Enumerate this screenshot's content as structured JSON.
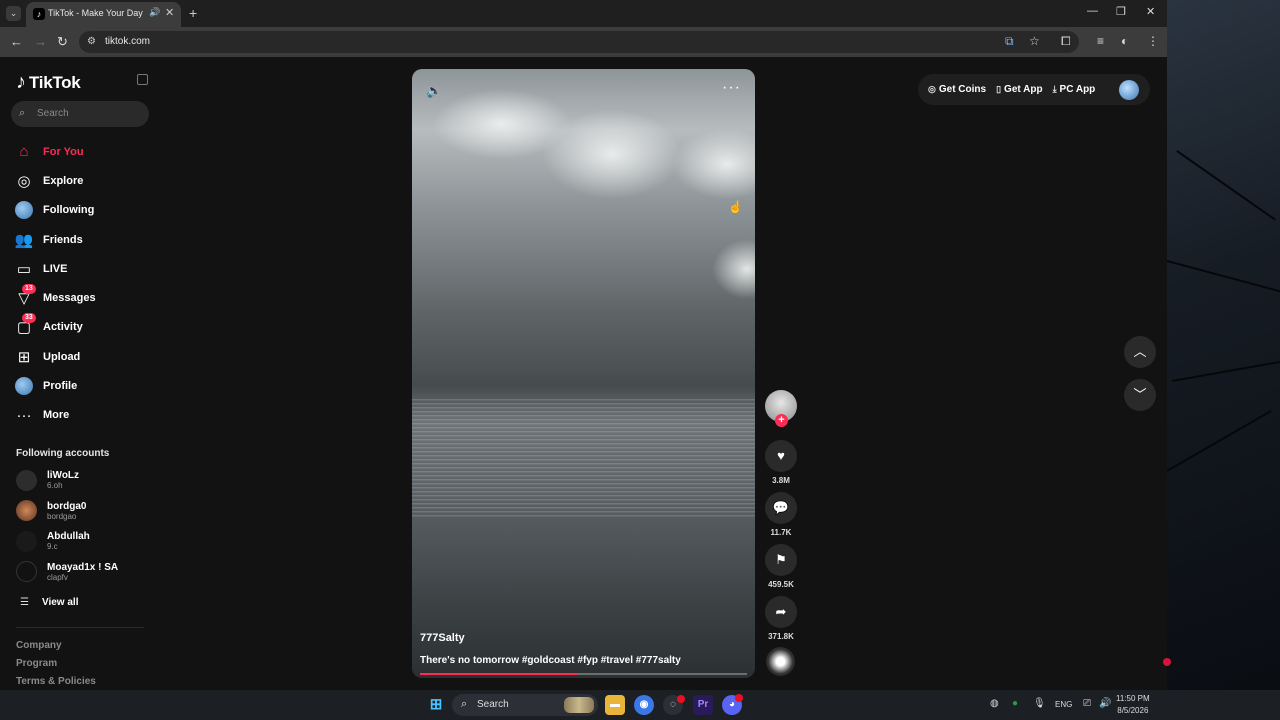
{
  "browser": {
    "tab_title": "TikTok - Make Your Day",
    "tab_favicon": "♪",
    "url": "tiktok.com"
  },
  "sidebar": {
    "logo_text": "TikTok",
    "search_placeholder": "Search",
    "nav": [
      {
        "label": "For You",
        "icon": "home-icon",
        "active": true
      },
      {
        "label": "Explore",
        "icon": "compass-icon"
      },
      {
        "label": "Following",
        "icon": "following-avatar-icon"
      },
      {
        "label": "Friends",
        "icon": "friends-icon"
      },
      {
        "label": "LIVE",
        "icon": "live-tv-icon"
      },
      {
        "label": "Messages",
        "icon": "messages-icon",
        "badge": "13"
      },
      {
        "label": "Activity",
        "icon": "activity-icon",
        "badge": "33"
      },
      {
        "label": "Upload",
        "icon": "upload-icon"
      },
      {
        "label": "Profile",
        "icon": "profile-avatar-icon"
      },
      {
        "label": "More",
        "icon": "more-icon"
      }
    ],
    "following_title": "Following accounts",
    "following": [
      {
        "name": "liWoLz",
        "handle": "6.oh"
      },
      {
        "name": "bordga0",
        "handle": "bordgao"
      },
      {
        "name": "Abdullah",
        "handle": "9.c"
      },
      {
        "name": "Moayad1x ! SA",
        "handle": "clapfv"
      }
    ],
    "view_all": "View all",
    "footer": [
      "Company",
      "Program",
      "Terms & Policies"
    ]
  },
  "video": {
    "author": "777Salty",
    "caption": "There's no tomorrow #goldcoast #fyp #travel #777salty",
    "progress": 0.48
  },
  "actions": {
    "likes": "3.8M",
    "comments": "11.7K",
    "saves": "459.5K",
    "shares": "371.8K"
  },
  "top_actions": {
    "get_coins": "Get Coins",
    "get_app": "Get App",
    "pc_app": "PC App"
  },
  "taskbar": {
    "search": "Search",
    "language": "ENG",
    "time": "11:50 PM",
    "date": "8/5/2026"
  },
  "colors": {
    "accent": "#fe2c55",
    "background": "#121212"
  }
}
